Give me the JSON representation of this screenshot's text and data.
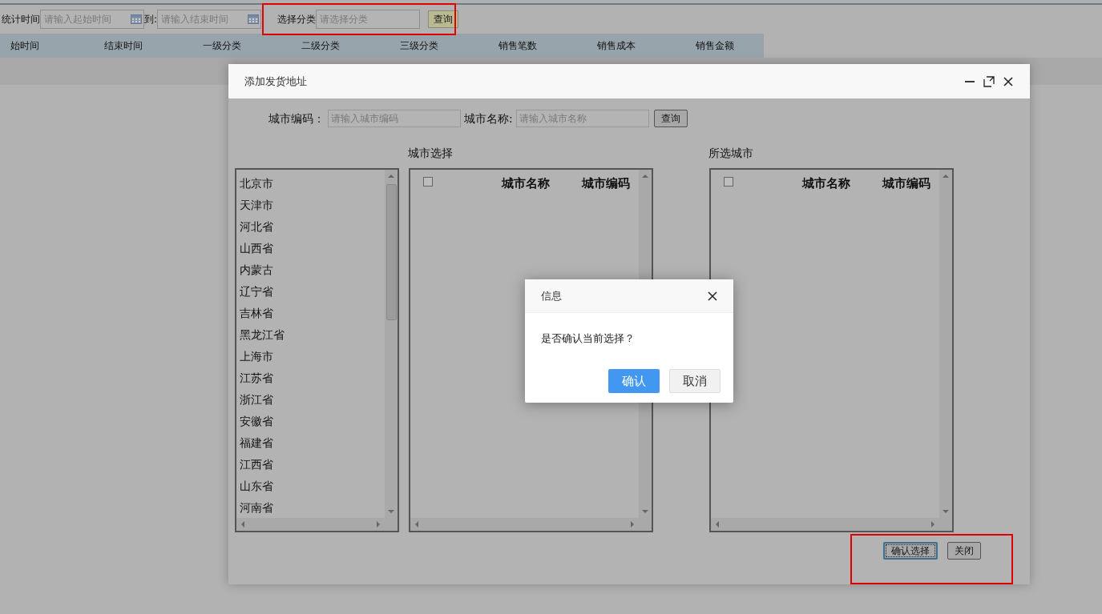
{
  "toolbar": {
    "fields": [
      {
        "label": "统计时间",
        "placeholder": "请输入起始时间",
        "kind": "date"
      },
      {
        "label": "到:",
        "placeholder": "请输入结束时间",
        "kind": "date"
      },
      {
        "label": "选择分类",
        "placeholder": "请选择分类",
        "kind": "text"
      }
    ],
    "query_button": "查询"
  },
  "table": {
    "columns": [
      "始时间",
      "结束时间",
      "一级分类",
      "二级分类",
      "三级分类",
      "销售笔数",
      "销售成本",
      "销售金额"
    ]
  },
  "dialog": {
    "title": "添加发货地址",
    "search": [
      {
        "label": "城市编码：",
        "placeholder": "请输入城市编码"
      },
      {
        "label": "城市名称:",
        "placeholder": "请输入城市名称"
      }
    ],
    "search_button": "查询",
    "provinces": [
      "北京市",
      "天津市",
      "河北省",
      "山西省",
      "内蒙古",
      "辽宁省",
      "吉林省",
      "黑龙江省",
      "上海市",
      "江苏省",
      "浙江省",
      "安徽省",
      "福建省",
      "江西省",
      "山东省",
      "河南省"
    ],
    "tables": [
      {
        "title": "城市选择",
        "checked": false,
        "columns": [
          "城市名称",
          "城市编码"
        ]
      },
      {
        "title": "所选城市",
        "checked": false,
        "columns": [
          "城市名称",
          "城市编码"
        ]
      }
    ],
    "buttons": [
      {
        "label": "确认选择",
        "kind": "focused"
      },
      {
        "label": "关闭",
        "kind": "normal"
      }
    ]
  },
  "message": {
    "title": "信息",
    "text": "是否确认当前选择？",
    "buttons": [
      {
        "label": "确认",
        "kind": "primary"
      },
      {
        "label": "取消",
        "kind": "secondary"
      }
    ]
  }
}
